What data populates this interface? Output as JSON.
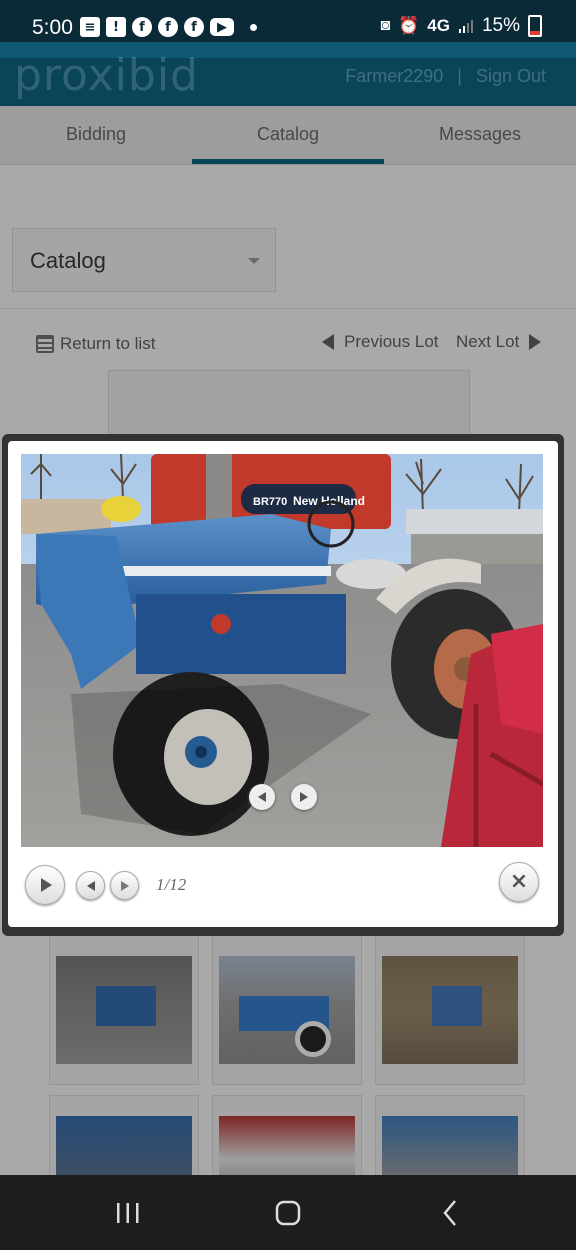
{
  "status": {
    "time": "5:00",
    "left_icons": [
      "message-icon",
      "alert-icon",
      "facebook-icon",
      "facebook-icon",
      "facebook-icon",
      "youtube-icon",
      "dot-icon"
    ],
    "network": "4G",
    "battery": "15%"
  },
  "header": {
    "logo": "proxibid",
    "username": "Farmer2290",
    "separator": "|",
    "signout": "Sign Out"
  },
  "tabs": [
    {
      "label": "Bidding",
      "active": false
    },
    {
      "label": "Catalog",
      "active": true
    },
    {
      "label": "Messages",
      "active": false
    }
  ],
  "catalog_select": {
    "value": "Catalog"
  },
  "lot_nav": {
    "return_label": "Return to list",
    "previous_label": "Previous Lot",
    "next_label": "Next Lot"
  },
  "lightbox": {
    "counter": "1/12",
    "photo_text": {
      "brand": "New Holland",
      "model": "BR770"
    }
  },
  "colors": {
    "header_bg": "#0e5871",
    "status_bg": "#0b2a37",
    "tractor_blue": "#2f6fb3",
    "baler_red": "#c0392b"
  }
}
